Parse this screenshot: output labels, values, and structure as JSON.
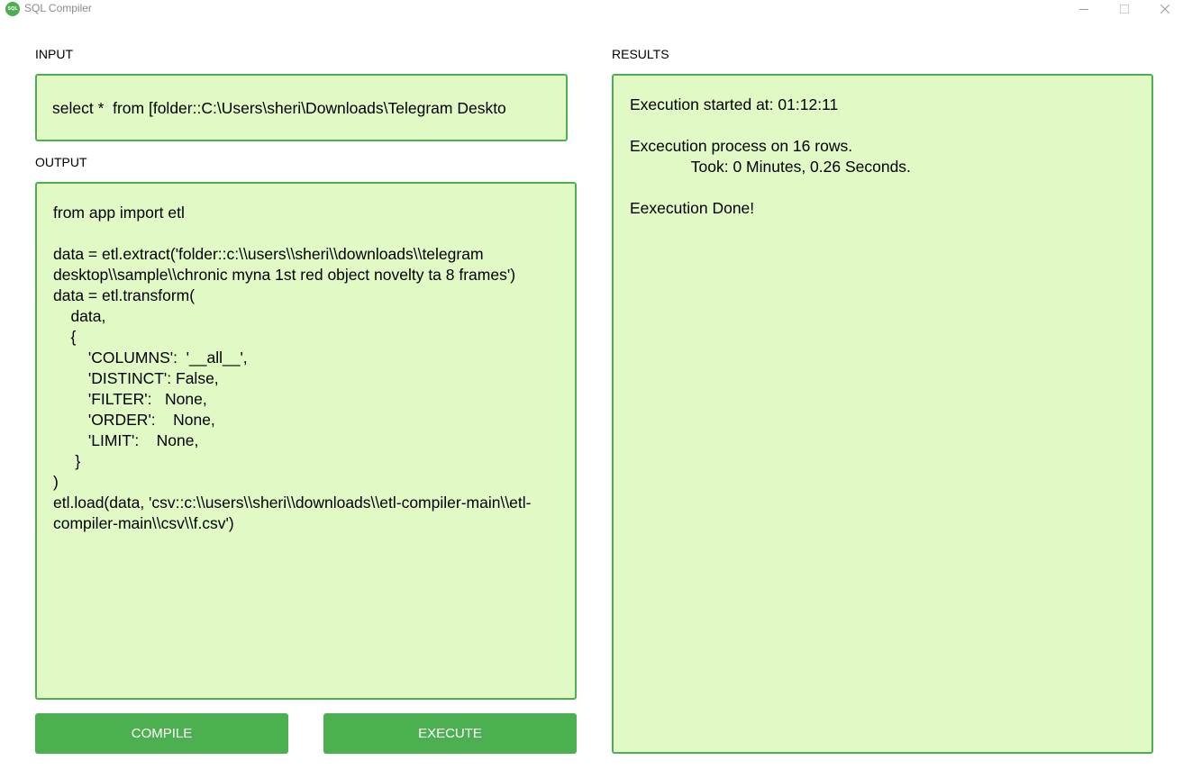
{
  "window": {
    "title": "SQL Compiler",
    "icon_text": "SQL",
    "accent_color": "#4caf50",
    "panel_color": "#e1f9c5"
  },
  "input": {
    "label": "INPUT",
    "query": "select *  from [folder::C:\\Users\\sheri\\Downloads\\Telegram Deskto"
  },
  "output": {
    "label": "OUTPUT",
    "code": "from app import etl\n\ndata = etl.extract('folder::c:\\\\users\\\\sheri\\\\downloads\\\\telegram desktop\\\\sample\\\\chronic myna 1st red object novelty ta 8 frames')\ndata = etl.transform(\n    data,\n    {\n        'COLUMNS':  '__all__',\n        'DISTINCT': False,\n        'FILTER':   None,\n        'ORDER':    None,\n        'LIMIT':    None,\n     }\n)\netl.load(data, 'csv::c:\\\\users\\\\sheri\\\\downloads\\\\etl-compiler-main\\\\etl-compiler-main\\\\csv\\\\f.csv')"
  },
  "results": {
    "label": "RESULTS",
    "text": "Execution started at: 01:12:11\n\nExcecution process on 16 rows.\n              Took: 0 Minutes, 0.26 Seconds.\n\nEexecution Done!"
  },
  "buttons": {
    "compile": "COMPILE",
    "execute": "EXECUTE"
  }
}
